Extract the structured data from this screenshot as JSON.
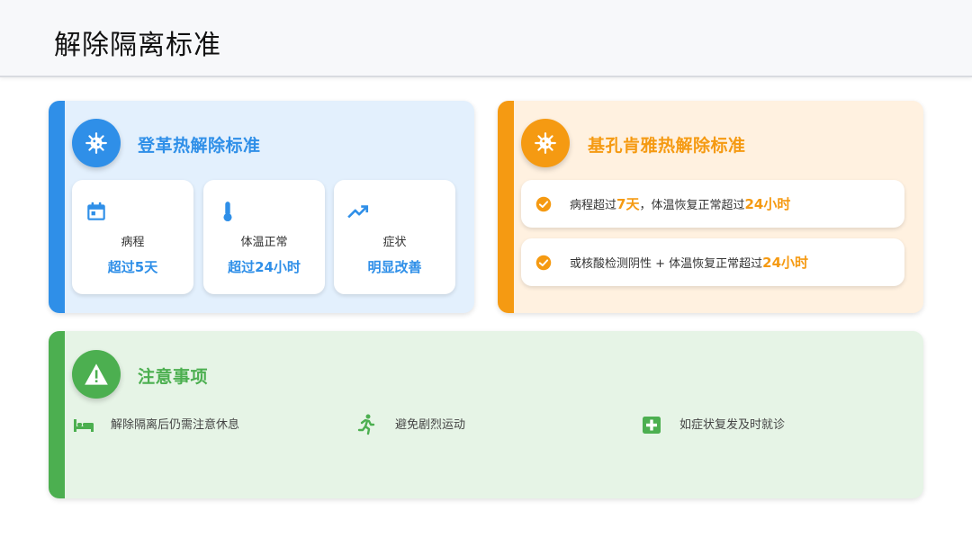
{
  "header": {
    "title": "解除隔离标准"
  },
  "dengue": {
    "title": "登革热解除标准",
    "accent": "#2f8fe8",
    "icon": "virus-icon",
    "items": [
      {
        "icon": "calendar-icon",
        "label": "病程",
        "value": "超过5天"
      },
      {
        "icon": "thermometer-icon",
        "label": "体温正常",
        "value": "超过24小时"
      },
      {
        "icon": "trending-up-icon",
        "label": "症状",
        "value": "明显改善"
      }
    ]
  },
  "chikungunya": {
    "title": "基孔肯雅热解除标准",
    "accent": "#f59a12",
    "icon": "virus-icon",
    "criteria": [
      {
        "p1": "病程超过",
        "h1": "7天",
        "p2": "，体温恢复正常超过",
        "h2": "24小时"
      },
      {
        "p1": "或核酸检测阴性 + 体温恢复正常超过",
        "h1": "24小时",
        "p2": "",
        "h2": ""
      }
    ]
  },
  "notes": {
    "title": "注意事项",
    "accent": "#4caf50",
    "icon": "warning-icon",
    "items": [
      {
        "icon": "bed-icon",
        "text": "解除隔离后仍需注意休息"
      },
      {
        "icon": "running-icon",
        "text": "避免剧烈运动"
      },
      {
        "icon": "medical-cross-icon",
        "text": "如症状复发及时就诊"
      }
    ]
  }
}
